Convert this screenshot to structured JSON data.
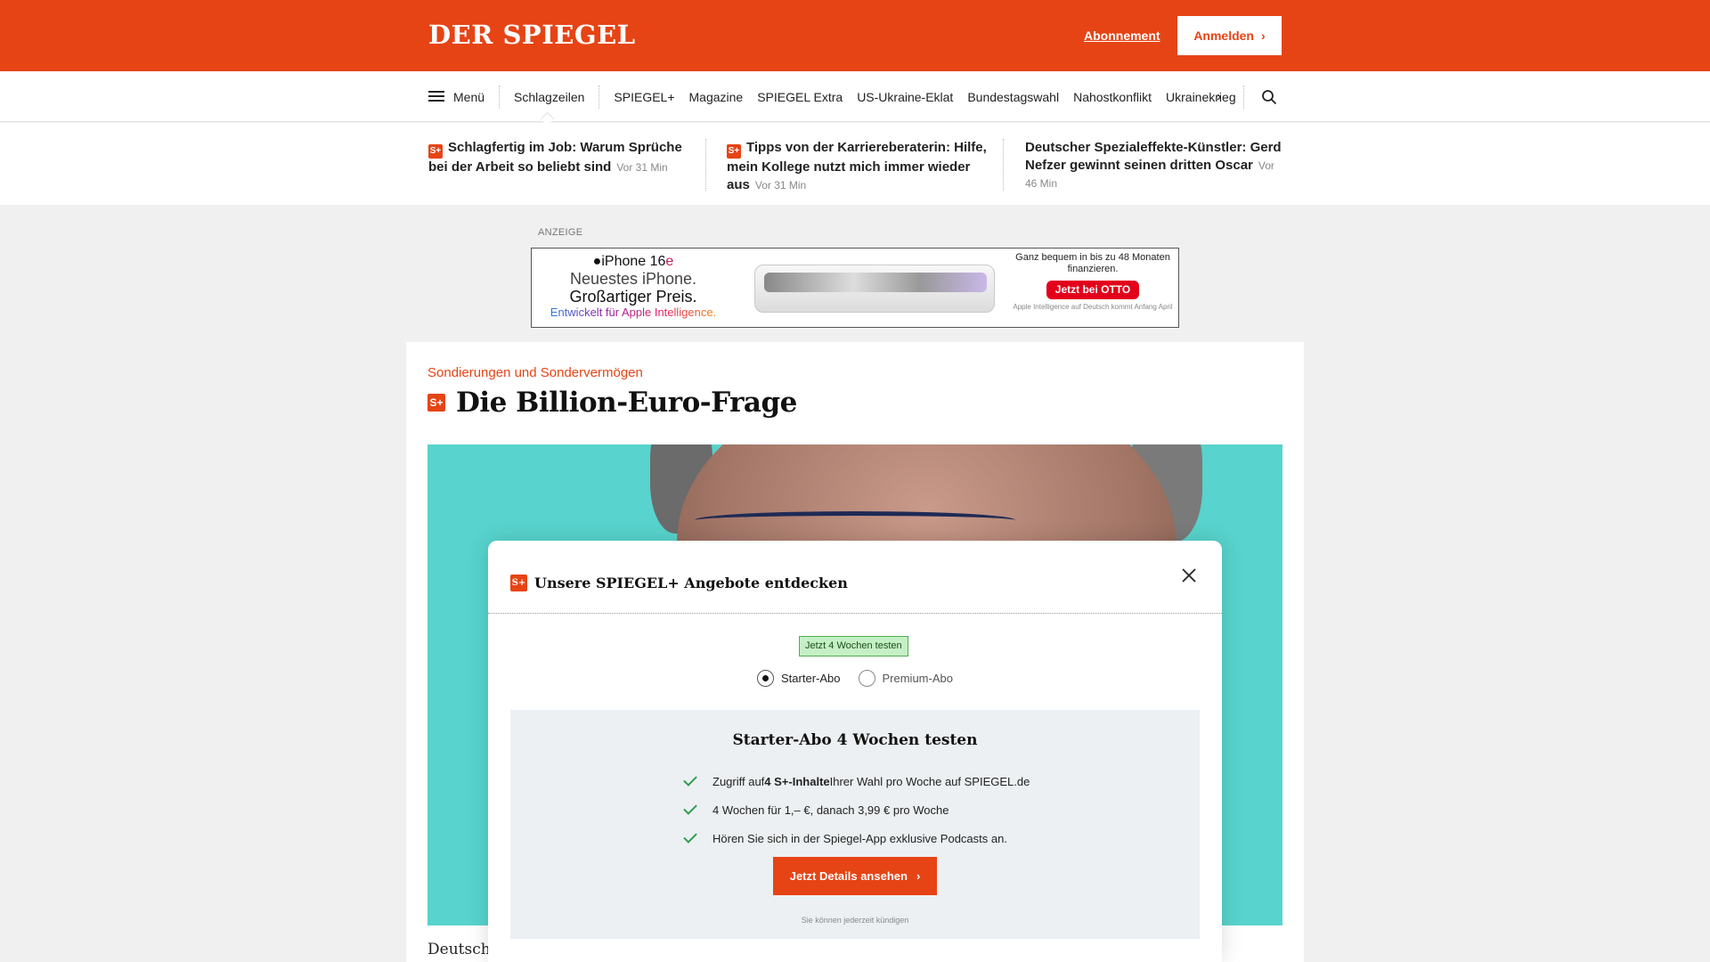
{
  "header": {
    "logo": "DER SPIEGEL",
    "subscription_link": "Abonnement",
    "login_button": "Anmelden",
    "brand_color": "#e64415"
  },
  "nav": {
    "menu_label": "Menü",
    "items": [
      "Schlagzeilen",
      "SPIEGEL+",
      "Magazine",
      "SPIEGEL Extra",
      "US-Ukraine-Eklat",
      "Bundestagswahl",
      "Nahostkonflikt",
      "Ukrainekrieg"
    ],
    "more_icon": "chevron-right-icon",
    "search_icon": "search-icon"
  },
  "teasers": [
    {
      "badge": "S+",
      "title": "Schlagfertig im Job: Warum Sprüche bei der Arbeit so beliebt sind",
      "time": "Vor 31 Min"
    },
    {
      "badge": "S+",
      "title": "Tipps von der Karriereberaterin: Hilfe, mein Kollege nutzt mich immer wieder aus",
      "time": "Vor 31 Min"
    },
    {
      "title": "Deutscher Spezialeffekte-Künstler: Gerd Nefzer gewinnt seinen dritten Oscar",
      "time": "Vor 46 Min"
    }
  ],
  "ad": {
    "label": "ANZEIGE",
    "brand": "iPhone 16",
    "brand_suffix": "e",
    "line1": "Neuestes iPhone.",
    "line2": "Großartiger Preis.",
    "intelligence": "Entwickelt für Apple Intelligence.",
    "finance_text": "Ganz bequem in bis zu 48 Monaten finanzieren.",
    "cta": "Jetzt bei OTTO",
    "footnote": "Apple Intelligence auf Deutsch kommt Anfang April"
  },
  "article": {
    "kicker": "Sondierungen und Sondervermögen",
    "badge": "S+",
    "headline": "Die Billion-Euro-Frage",
    "teaser_start": "Deutschl"
  },
  "modal": {
    "badge": "S+",
    "title": "Unsere SPIEGEL+ Angebote entdecken",
    "trial_badge": "Jetzt 4 Wochen testen",
    "options": [
      "Starter-Abo",
      "Premium-Abo"
    ],
    "selected_option": "Starter-Abo",
    "offer_title": "Starter-Abo 4 Wochen testen",
    "features": [
      {
        "pre": "Zugriff auf ",
        "bold": "4 S+-Inhalte",
        "post": " Ihrer Wahl pro Woche auf SPIEGEL.de"
      },
      {
        "pre": "4 Wochen für 1,– €, danach 3,99 € pro Woche",
        "bold": "",
        "post": ""
      },
      {
        "pre": "Hören Sie sich in der Spiegel-App exklusive Podcasts an.",
        "bold": "",
        "post": ""
      }
    ],
    "cta": "Jetzt Details ansehen",
    "cancel_note": "Sie können jederzeit kündigen"
  }
}
